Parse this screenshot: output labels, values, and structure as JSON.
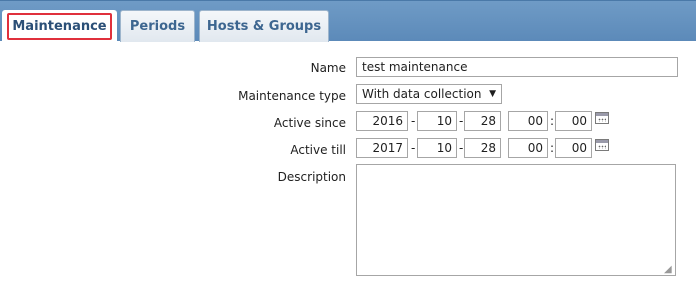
{
  "tabs": {
    "maintenance": "Maintenance",
    "periods": "Periods",
    "hosts_groups": "Hosts & Groups"
  },
  "form": {
    "name_label": "Name",
    "name_value": "test maintenance",
    "type_label": "Maintenance type",
    "type_value": "With data collection",
    "since_label": "Active since",
    "since": {
      "year": "2016",
      "month": "10",
      "day": "28",
      "hour": "00",
      "minute": "00"
    },
    "till_label": "Active till",
    "till": {
      "year": "2017",
      "month": "10",
      "day": "28",
      "hour": "00",
      "minute": "00"
    },
    "description_label": "Description",
    "description_value": "",
    "date_sep": "-",
    "time_sep": ":"
  },
  "icons": {
    "calendar": "calendar-icon",
    "dropdown": "chevron-down-icon"
  }
}
